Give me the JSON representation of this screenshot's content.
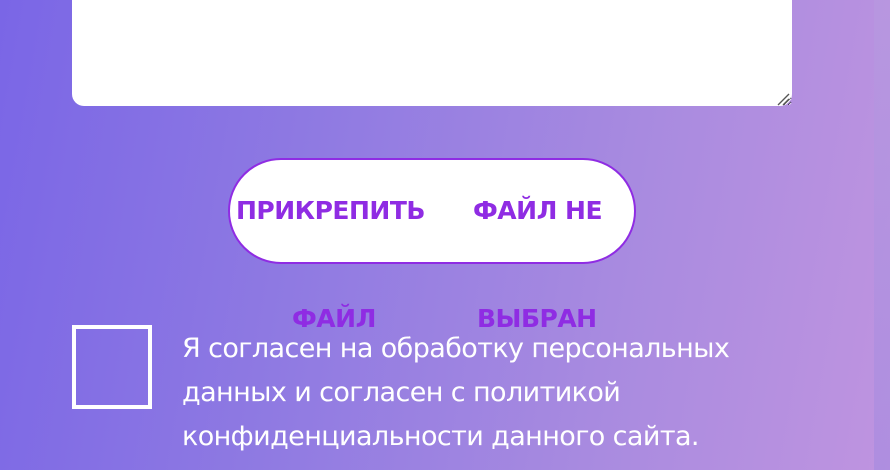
{
  "form": {
    "message": {
      "value": ""
    },
    "file_upload": {
      "label_part1_line1": "ПРИКРЕПИТЬ",
      "label_part1_line2": "ФАЙЛ",
      "label_part2_line1": "ФАЙЛ НЕ",
      "label_part2_line2": "ВЫБРАН"
    },
    "consent": {
      "text": "Я согласен на обработку персональных данных и согласен с политикой конфиденциальности данного сайта.",
      "checked": false
    }
  },
  "colors": {
    "accent": "#8f2ce3",
    "background_start": "#7a66e6",
    "background_end": "#bf94e0",
    "text_light": "#ffffff"
  }
}
